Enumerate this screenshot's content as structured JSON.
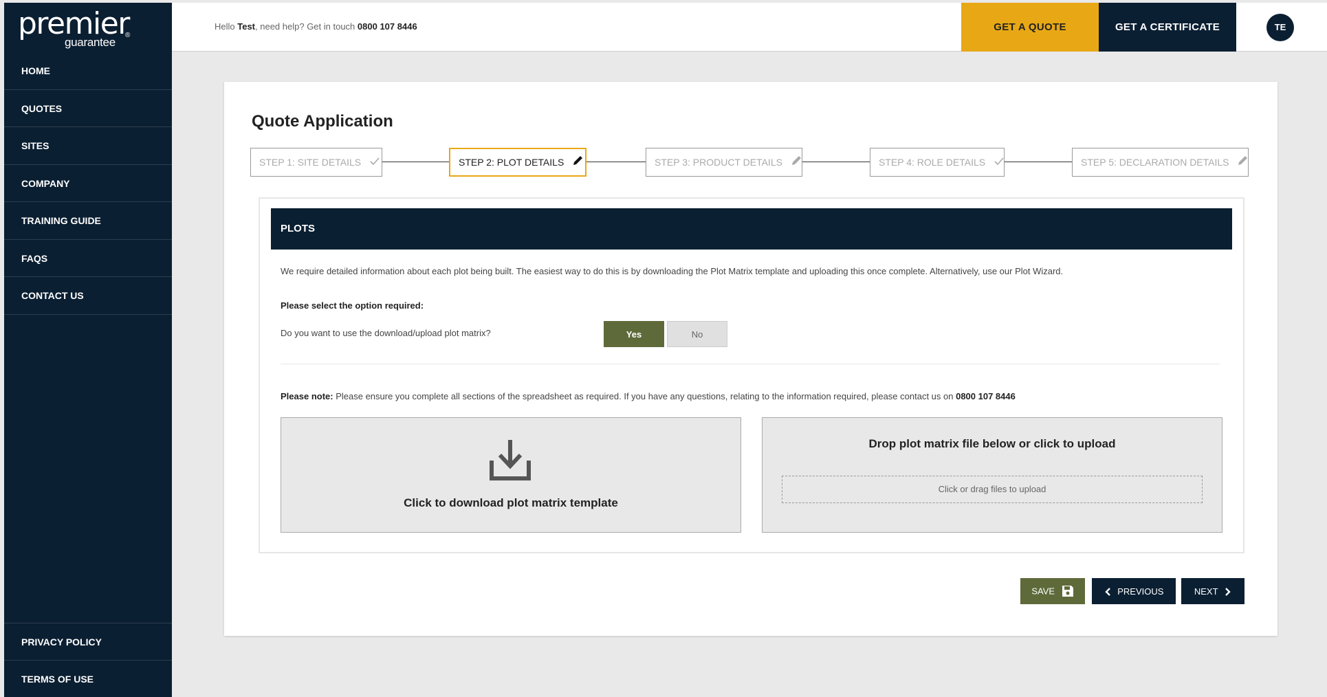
{
  "brand": {
    "logo_main": "premier",
    "logo_sub": "guarantee",
    "logo_mark": "®"
  },
  "sidebar": {
    "items": [
      {
        "label": "HOME"
      },
      {
        "label": "QUOTES"
      },
      {
        "label": "SITES"
      },
      {
        "label": "COMPANY"
      },
      {
        "label": "TRAINING GUIDE"
      },
      {
        "label": "FAQS"
      },
      {
        "label": "CONTACT US"
      }
    ],
    "bottom_items": [
      {
        "label": "PRIVACY POLICY"
      },
      {
        "label": "TERMS OF USE"
      }
    ]
  },
  "header": {
    "greeting_prefix": "Hello",
    "user_name": "Test",
    "greeting_mid": ", need help? Get in touch",
    "phone": "0800 107 8446",
    "get_quote_label": "GET A QUOTE",
    "get_certificate_label": "GET A CERTIFICATE",
    "avatar_initials": "TE"
  },
  "page": {
    "title": "Quote Application",
    "steps": [
      {
        "label": "STEP 1: SITE DETAILS",
        "icon": "check-icon"
      },
      {
        "label": "STEP 2: PLOT DETAILS",
        "icon": "pencil-icon"
      },
      {
        "label": "STEP 3: PRODUCT DETAILS",
        "icon": "pencil-icon"
      },
      {
        "label": "STEP 4: ROLE DETAILS",
        "icon": "check-icon"
      },
      {
        "label": "STEP 5: DECLARATION DETAILS",
        "icon": "pencil-icon"
      }
    ]
  },
  "plots": {
    "heading": "PLOTS",
    "intro": "We require detailed information about each plot being built. The easiest way to do this is by downloading the Plot Matrix template and uploading this once complete. Alternatively, use our Plot Wizard.",
    "select_label": "Please select the option required:",
    "question": "Do you want to use the download/upload plot matrix?",
    "yes_label": "Yes",
    "no_label": "No",
    "note_label": "Please note:",
    "note_text": " Please ensure you complete all sections of the spreadsheet as required. If you have any questions, relating to the information required, please contact us on ",
    "note_phone": "0800 107 8446",
    "download_text": "Click to download plot matrix template",
    "upload_title": "Drop plot matrix file below or click to upload",
    "dropzone_text": "Click or drag files to upload"
  },
  "actions": {
    "save_label": "SAVE",
    "previous_label": "PREVIOUS",
    "next_label": "NEXT"
  },
  "colors": {
    "navy": "#0b1f32",
    "accent_yellow": "#e8a815",
    "olive": "#5e6a3a"
  }
}
